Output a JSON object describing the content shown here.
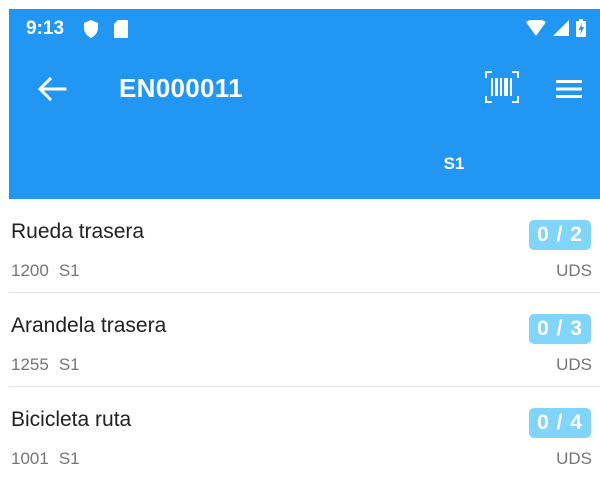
{
  "status_bar": {
    "time": "9:13"
  },
  "app_bar": {
    "title": "EN000011"
  },
  "tabs": [
    {
      "label": "S1"
    }
  ],
  "items": [
    {
      "name": "Rueda trasera",
      "code": "1200",
      "location": "S1",
      "progress": "0 / 2",
      "unit": "UDS"
    },
    {
      "name": "Arandela trasera",
      "code": "1255",
      "location": "S1",
      "progress": "0 / 3",
      "unit": "UDS"
    },
    {
      "name": "Bicicleta ruta",
      "code": "1001",
      "location": "S1",
      "progress": "0 / 4",
      "unit": "UDS"
    }
  ],
  "colors": {
    "primary": "#2196f3",
    "badge": "#81d4fa"
  }
}
